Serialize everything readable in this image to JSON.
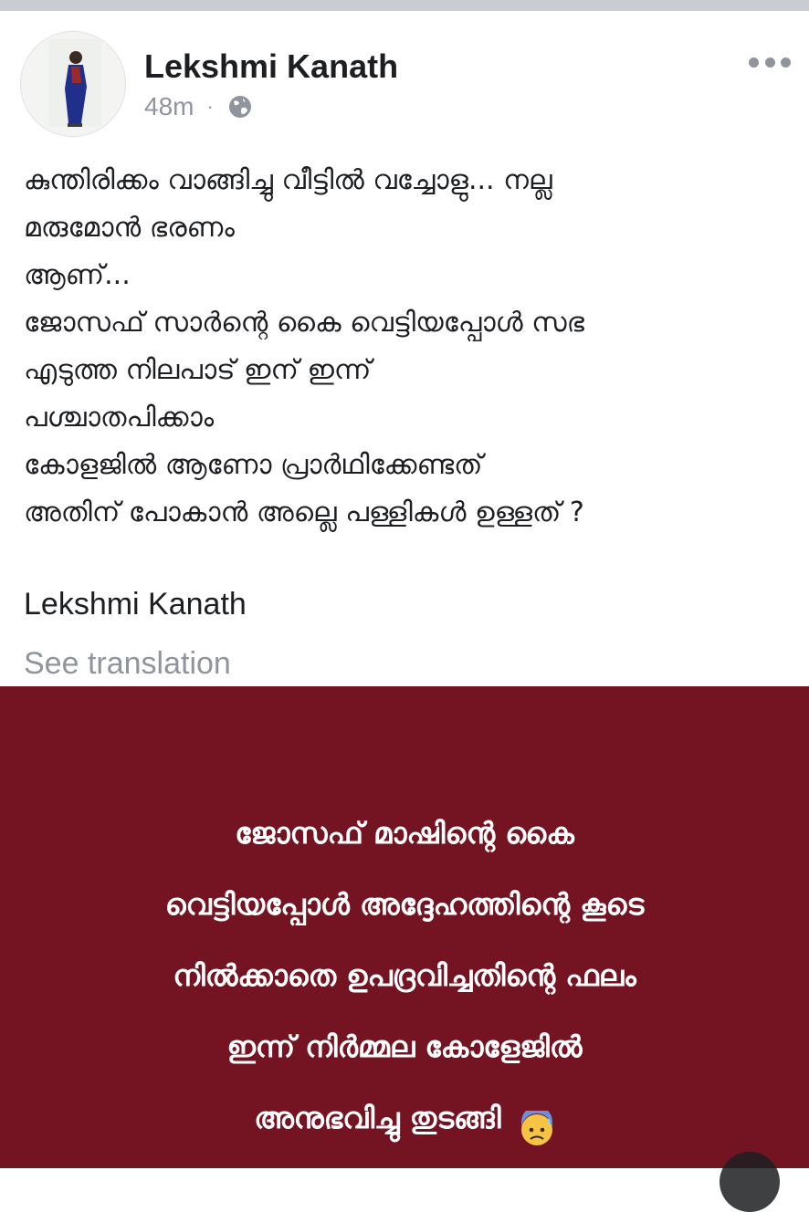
{
  "post": {
    "author": "Lekshmi Kanath",
    "timestamp": "48m",
    "separator": "·",
    "privacy_icon": "globe-icon",
    "more_icon": "more-horizontal-icon",
    "lines": [
      "കുന്തിരിക്കം വാങ്ങിച്ചു വീട്ടിൽ വച്ചോളു... നല്ല",
      "മരുമോൻ ഭരണം",
      "ആണ്...",
      "ജോസഫ് സാർന്റെ കൈ വെട്ടിയപ്പോൾ സഭ",
      "എടുത്ത നിലപാട് ഇന് ഇന്ന്",
      "പശ്ചാതപിക്കാം",
      "കോളജിൽ ആണോ പ്രാർഥിക്കേണ്ടത്",
      "അതിന് പോകാൻ അല്ലെ പള്ളികൾ ഉള്ളത് ?"
    ],
    "signature": "Lekshmi Kanath",
    "see_translation": "See translation"
  },
  "image_card": {
    "background": "#741422",
    "lines": [
      "ജോസഫ് മാഷിന്റെ കൈ",
      "വെട്ടിയപ്പോൾ അദ്ദേഹത്തിന്റെ കൂടെ",
      "നിൽക്കാതെ ഉപദ്രവിച്ചതിന്റെ ഫലം",
      "ഇന്ന് നിർമ്മല കോളേജിൽ",
      "അനുഭവിച്ചു തുടങ്ങി"
    ],
    "emoji": "anxious-face-with-sweat-icon"
  }
}
